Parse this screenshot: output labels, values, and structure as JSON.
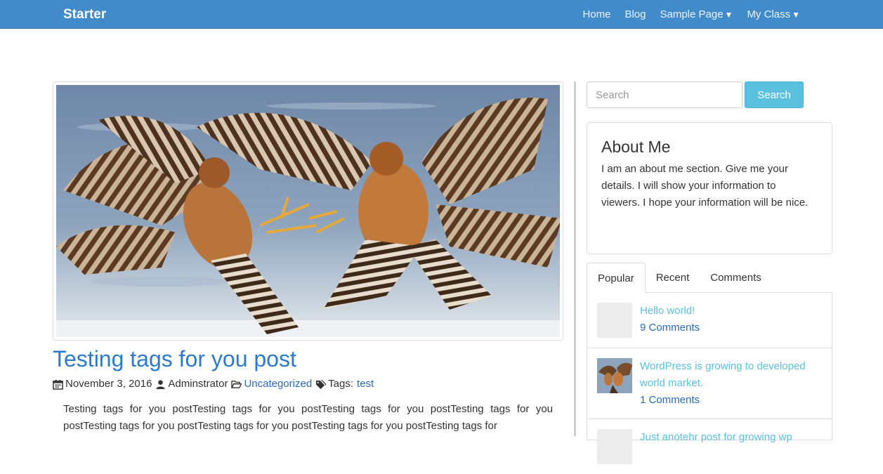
{
  "navbar": {
    "brand": "Starter",
    "links": [
      {
        "label": "Home",
        "caret": ""
      },
      {
        "label": "Blog",
        "caret": ""
      },
      {
        "label": "Sample Page",
        "caret": "▼"
      },
      {
        "label": "My Class",
        "caret": "▼"
      }
    ]
  },
  "post": {
    "title": "Testing tags for you post",
    "date": "November 3, 2016",
    "author": "Adminstrator",
    "category": "Uncategorized",
    "tags_label": "Tags:",
    "tag": "test",
    "excerpt": "Testing tags for you postTesting tags for you postTesting tags for you postTesting tags for you postTesting tags for you postTesting tags for you postTesting tags for you postTesting tags for"
  },
  "sidebar": {
    "search": {
      "placeholder": "Search",
      "button": "Search"
    },
    "about": {
      "title": "About Me",
      "text": "I am an about me section. Give me your details. I will show your information to viewers. I hope your information will be nice."
    },
    "tabs": [
      {
        "label": "Popular",
        "active": true
      },
      {
        "label": "Recent",
        "active": false
      },
      {
        "label": "Comments",
        "active": false
      }
    ],
    "popular_posts": [
      {
        "title": "Hello world!",
        "comments": "9 Comments"
      },
      {
        "title": "WordPress is growing to developed world market.",
        "comments": "1 Comments"
      },
      {
        "title": "Just anotehr post for growing wp",
        "comments": ""
      }
    ]
  },
  "colors": {
    "navbar": "#428bca",
    "link": "#2a7bd0",
    "info": "#5bc0de"
  }
}
